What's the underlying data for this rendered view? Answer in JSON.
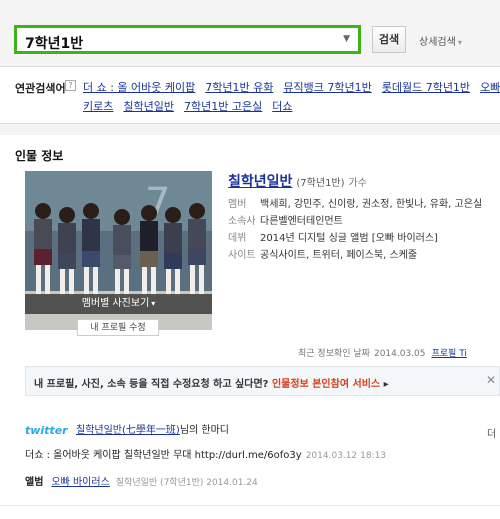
{
  "search": {
    "query": "7학년1반",
    "button_label": "검색",
    "detail_label": "상세검색"
  },
  "related": {
    "label": "연관검색어",
    "row1": [
      "더 쇼 : 올 어바웃 케이팝",
      "7학년1반 유화",
      "뮤직뱅크 7학년1반",
      "롯데월드 7학년1반",
      "오빠 바이"
    ],
    "row2": [
      "키로츠",
      "칠학년일반",
      "7학년1반 고은실",
      "더쇼"
    ]
  },
  "profile": {
    "section_title": "인물 정보",
    "photo_caption": "멤버별 사진보기",
    "edit_label": "내 프로필 수정",
    "name": "칠학년일반",
    "hanja": "(7학년1반)",
    "role": "가수",
    "rows": [
      {
        "k": "멤버",
        "v": "백세희, 강민주, 신이랑, 권소정, 한빛나, 유화, 고은실"
      },
      {
        "k": "소속사",
        "v": "다른벨엔터테인먼트"
      },
      {
        "k": "데뷔",
        "v": "2014년 디지털 싱글 앨범 [오빠 바이러스]"
      },
      {
        "k": "사이트",
        "v": "공식사이트, 트위터, 페이스북, 스케줄"
      }
    ],
    "updated_label": "최근 정보확인 날짜",
    "updated_date": "2014.03.05",
    "report_label": "프로필 Ti"
  },
  "notice": {
    "text": "내 프로필, 사진, 소속 등을 직접 수정요청 하고 싶다면?",
    "link": "인물정보 본인참여 서비스"
  },
  "twitter": {
    "logo": "twitter",
    "who": "칠학년일반(七學年一班)",
    "suffix": "님의 한마디",
    "more": "더",
    "body": "더쇼 : 올어바웃 케이팝 칠학년일반 무대 http://durl.me/6ofo3y",
    "date": "2014.03.12 18:13"
  },
  "album": {
    "label": "앨범",
    "title": "오빠 바이러스",
    "meta": "칠학년일반 (7학년1반) 2014.01.24"
  },
  "colors": {
    "search_border": "#3cb319",
    "link": "#1a3399",
    "twitter": "#2aa9e0",
    "accent_red": "#d5401a"
  }
}
